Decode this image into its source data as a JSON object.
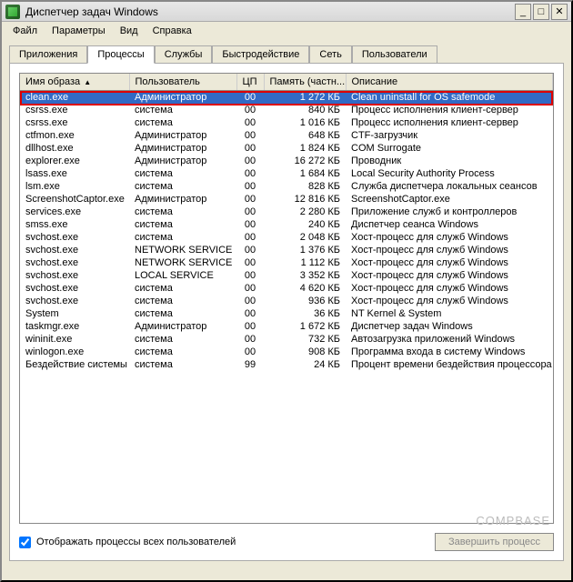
{
  "window": {
    "title": "Диспетчер задач Windows"
  },
  "menubar": {
    "items": [
      "Файл",
      "Параметры",
      "Вид",
      "Справка"
    ]
  },
  "tabs": {
    "items": [
      "Приложения",
      "Процессы",
      "Службы",
      "Быстродействие",
      "Сеть",
      "Пользователи"
    ],
    "active_index": 1
  },
  "columns": {
    "name": "Имя образа",
    "user": "Пользователь",
    "cpu": "ЦП",
    "memory": "Память (частн...",
    "description": "Описание"
  },
  "rows": [
    {
      "name": "clean.exe",
      "user": "Администратор",
      "cpu": "00",
      "mem": "1 272 КБ",
      "desc": "Clean uninstall for OS safemode",
      "selected": true,
      "highlighted": true
    },
    {
      "name": "csrss.exe",
      "user": "система",
      "cpu": "00",
      "mem": "840 КБ",
      "desc": "Процесс исполнения клиент-сервер"
    },
    {
      "name": "csrss.exe",
      "user": "система",
      "cpu": "00",
      "mem": "1 016 КБ",
      "desc": "Процесс исполнения клиент-сервер"
    },
    {
      "name": "ctfmon.exe",
      "user": "Администратор",
      "cpu": "00",
      "mem": "648 КБ",
      "desc": "CTF-загрузчик"
    },
    {
      "name": "dllhost.exe",
      "user": "Администратор",
      "cpu": "00",
      "mem": "1 824 КБ",
      "desc": "COM Surrogate"
    },
    {
      "name": "explorer.exe",
      "user": "Администратор",
      "cpu": "00",
      "mem": "16 272 КБ",
      "desc": "Проводник"
    },
    {
      "name": "lsass.exe",
      "user": "система",
      "cpu": "00",
      "mem": "1 684 КБ",
      "desc": "Local Security Authority Process"
    },
    {
      "name": "lsm.exe",
      "user": "система",
      "cpu": "00",
      "mem": "828 КБ",
      "desc": "Служба диспетчера локальных сеансов"
    },
    {
      "name": "ScreenshotCaptor.exe",
      "user": "Администратор",
      "cpu": "00",
      "mem": "12 816 КБ",
      "desc": "ScreenshotCaptor.exe"
    },
    {
      "name": "services.exe",
      "user": "система",
      "cpu": "00",
      "mem": "2 280 КБ",
      "desc": "Приложение служб и контроллеров"
    },
    {
      "name": "smss.exe",
      "user": "система",
      "cpu": "00",
      "mem": "240 КБ",
      "desc": "Диспетчер сеанса  Windows"
    },
    {
      "name": "svchost.exe",
      "user": "система",
      "cpu": "00",
      "mem": "2 048 КБ",
      "desc": "Хост-процесс для служб Windows"
    },
    {
      "name": "svchost.exe",
      "user": "NETWORK SERVICE",
      "cpu": "00",
      "mem": "1 376 КБ",
      "desc": "Хост-процесс для служб Windows"
    },
    {
      "name": "svchost.exe",
      "user": "NETWORK SERVICE",
      "cpu": "00",
      "mem": "1 112 КБ",
      "desc": "Хост-процесс для служб Windows"
    },
    {
      "name": "svchost.exe",
      "user": "LOCAL SERVICE",
      "cpu": "00",
      "mem": "3 352 КБ",
      "desc": "Хост-процесс для служб Windows"
    },
    {
      "name": "svchost.exe",
      "user": "система",
      "cpu": "00",
      "mem": "4 620 КБ",
      "desc": "Хост-процесс для служб Windows"
    },
    {
      "name": "svchost.exe",
      "user": "система",
      "cpu": "00",
      "mem": "936 КБ",
      "desc": "Хост-процесс для служб Windows"
    },
    {
      "name": "System",
      "user": "система",
      "cpu": "00",
      "mem": "36 КБ",
      "desc": "NT Kernel & System"
    },
    {
      "name": "taskmgr.exe",
      "user": "Администратор",
      "cpu": "00",
      "mem": "1 672 КБ",
      "desc": "Диспетчер задач Windows"
    },
    {
      "name": "wininit.exe",
      "user": "система",
      "cpu": "00",
      "mem": "732 КБ",
      "desc": "Автозагрузка приложений Windows"
    },
    {
      "name": "winlogon.exe",
      "user": "система",
      "cpu": "00",
      "mem": "908 КБ",
      "desc": "Программа входа в систему Windows"
    },
    {
      "name": "Бездействие системы",
      "user": "система",
      "cpu": "99",
      "mem": "24 КБ",
      "desc": "Процент времени бездействия процессора"
    }
  ],
  "footer": {
    "checkbox_label": "Отображать процессы всех пользователей",
    "checkbox_checked": true,
    "end_button": "Завершить процесс"
  },
  "watermark": "COMPBASE"
}
